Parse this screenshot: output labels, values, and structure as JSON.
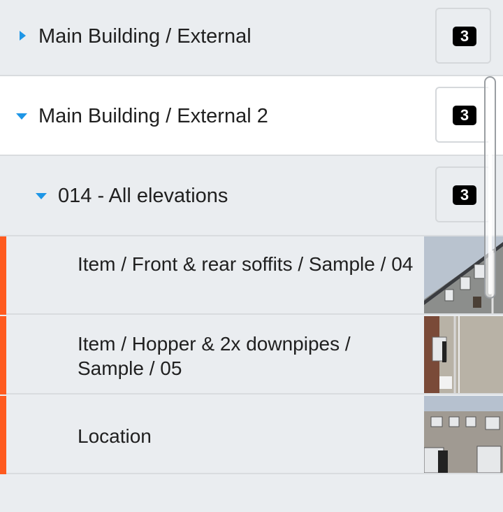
{
  "colors": {
    "accent": "#1e96e6",
    "status_orange": "#ff5a1f",
    "badge_bg": "#000000"
  },
  "groups": [
    {
      "label": "Main Building / External",
      "count": "3",
      "state": "collapsed",
      "icon": "chevron-right-icon"
    },
    {
      "label": "Main Building / External 2",
      "count": "3",
      "state": "expanded",
      "icon": "chevron-down-icon"
    }
  ],
  "subgroup": {
    "label": "014 - All elevations",
    "count": "3",
    "icon": "chevron-down-icon"
  },
  "items": [
    {
      "label": "Item / Front & rear soffits / Sample / 04",
      "status_color": "#ff5a1f",
      "thumbnail": "building-photo-soffits"
    },
    {
      "label": "Item / Hopper & 2x downpipes / Sample / 05",
      "status_color": "#ff5a1f",
      "thumbnail": "building-photo-downpipes"
    },
    {
      "label": "Location",
      "status_color": "#ff5a1f",
      "thumbnail": "building-photo-location"
    }
  ]
}
